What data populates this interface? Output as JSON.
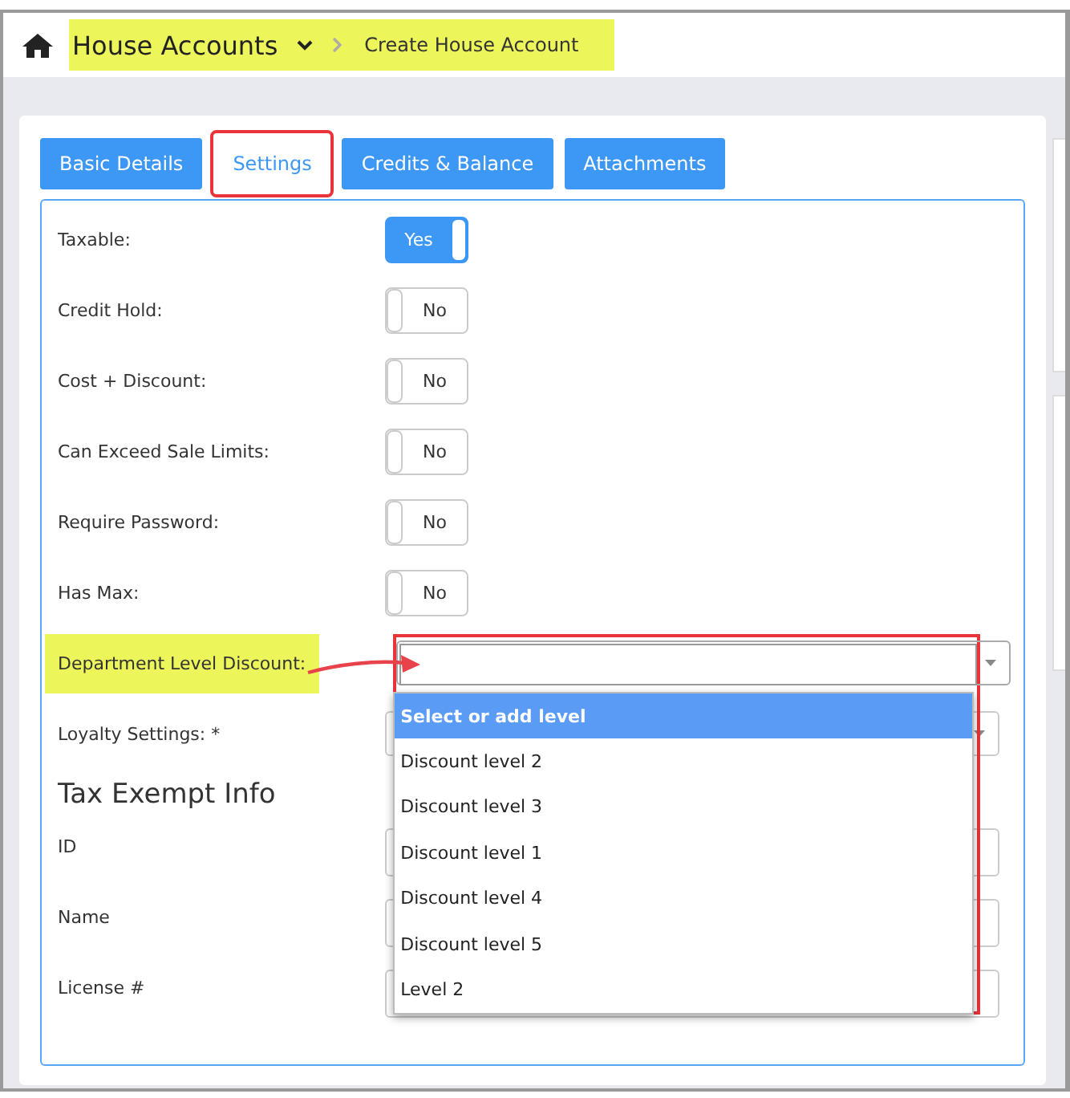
{
  "breadcrumb": {
    "section": "House Accounts",
    "page": "Create House Account",
    "highlighted": true
  },
  "tabs": [
    {
      "label": "Basic Details",
      "selected": false,
      "outlined": false
    },
    {
      "label": "Settings",
      "selected": true,
      "outlined": true
    },
    {
      "label": "Credits & Balance",
      "selected": false,
      "outlined": false
    },
    {
      "label": "Attachments",
      "selected": false,
      "outlined": false
    }
  ],
  "fields": [
    {
      "kind": "toggle",
      "label": "Taxable:",
      "on": true,
      "value": "Yes"
    },
    {
      "kind": "toggle",
      "label": "Credit Hold:",
      "on": false,
      "value": "No"
    },
    {
      "kind": "toggle",
      "label": "Cost + Discount:",
      "on": false,
      "value": "No"
    },
    {
      "kind": "toggle",
      "label": "Can Exceed Sale Limits:",
      "on": false,
      "value": "No"
    },
    {
      "kind": "toggle",
      "label": "Require Password:",
      "on": false,
      "value": "No"
    },
    {
      "kind": "toggle",
      "label": "Has Max:",
      "on": false,
      "value": "No"
    },
    {
      "kind": "select",
      "label": "Department Level Discount:",
      "highlighted": true,
      "open": true,
      "options": [
        {
          "label": "Select or add level",
          "selected": true
        },
        {
          "label": "Discount level 2",
          "selected": false
        },
        {
          "label": "Discount level 3",
          "selected": false
        },
        {
          "label": "Discount level 1",
          "selected": false
        },
        {
          "label": "Discount level 4",
          "selected": false
        },
        {
          "label": "Discount level 5",
          "selected": false
        },
        {
          "label": "Level 2",
          "selected": false
        }
      ]
    },
    {
      "kind": "select",
      "label": "Loyalty Settings: *",
      "highlighted": false,
      "open": false
    },
    {
      "kind": "heading",
      "label": "Tax Exempt Info"
    },
    {
      "kind": "text",
      "label": "ID"
    },
    {
      "kind": "text",
      "label": "Name"
    },
    {
      "kind": "text",
      "label": "License #"
    }
  ]
}
